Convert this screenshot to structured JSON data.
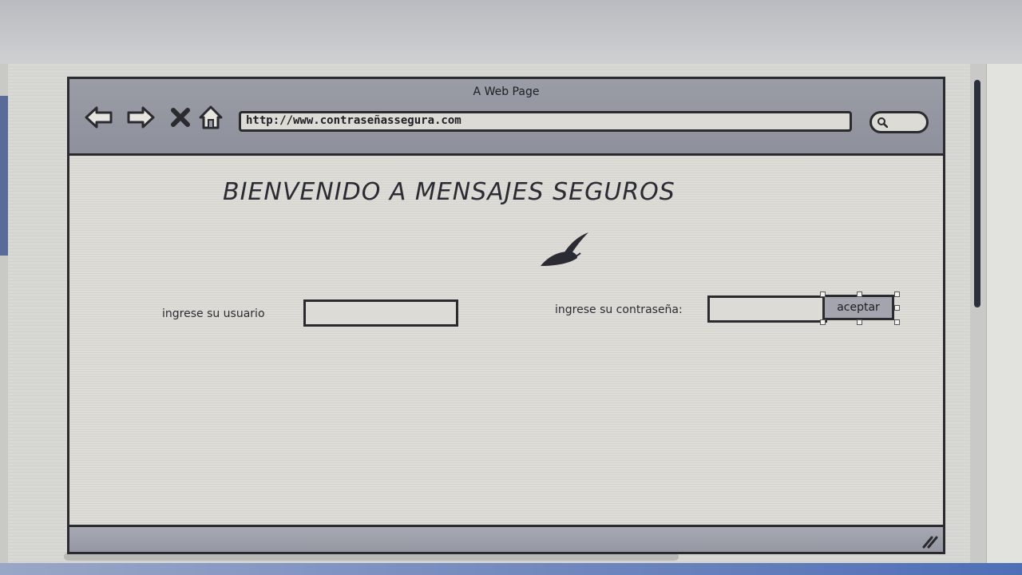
{
  "window": {
    "title": "A Web Page"
  },
  "toolbar": {
    "back_icon": "arrow-left-icon",
    "forward_icon": "arrow-right-icon",
    "stop_icon": "close-icon",
    "home_icon": "home-icon",
    "url": "http://www.contraseñassegura.com",
    "search_icon": "search-icon"
  },
  "page": {
    "heading": "BIENVENIDO A MENSAJES SEGUROS",
    "logo_icon": "quill-icon",
    "username_label": "ingrese su usuario",
    "username_value": "",
    "password_label": "ingrese su contraseña:",
    "password_value": "",
    "accept_label": "aceptar"
  },
  "colors": {
    "frame": "#2b2b2f",
    "chrome": "#9a9ca6",
    "canvas": "#dedcd7",
    "button": "#a4a4ae"
  }
}
